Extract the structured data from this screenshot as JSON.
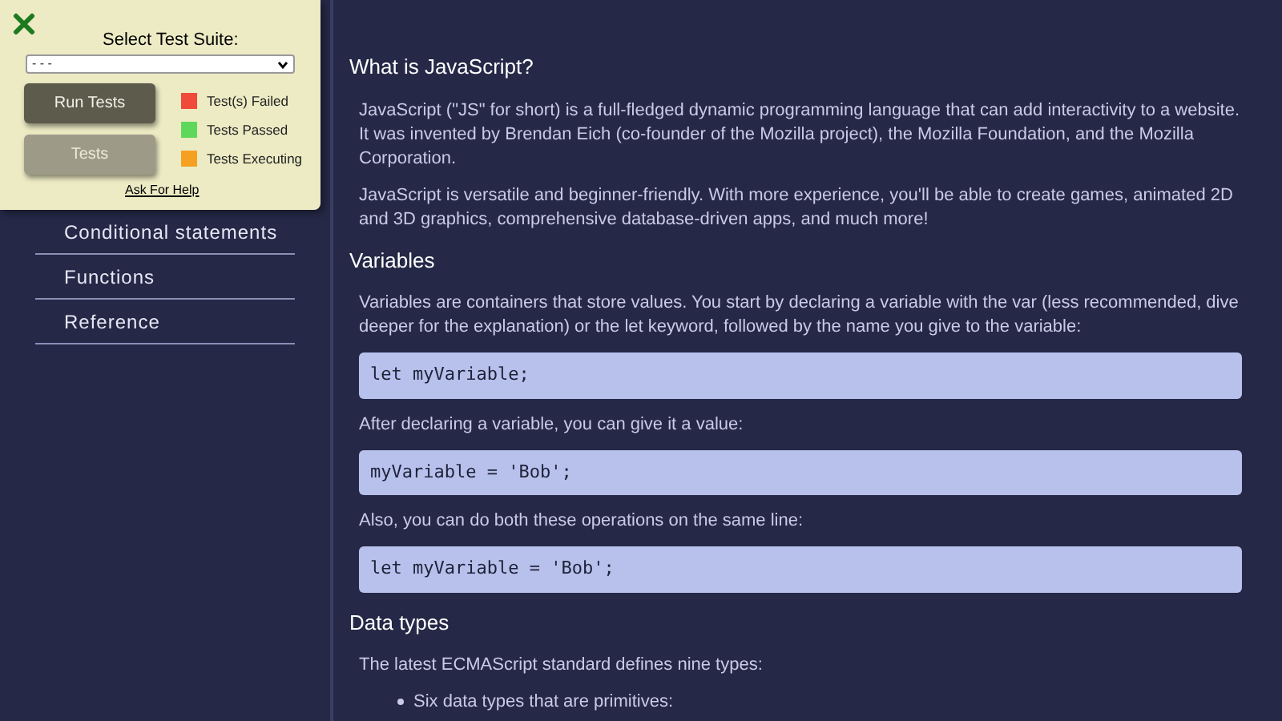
{
  "test_panel": {
    "title": "Select Test Suite:",
    "suite_select": {
      "value": "- - -"
    },
    "buttons": [
      {
        "label": "Run Tests",
        "disabled": false
      },
      {
        "label": "Tests",
        "disabled": true
      }
    ],
    "legend": [
      {
        "label": "Test(s) Failed",
        "color": "#f04a3a"
      },
      {
        "label": "Tests Passed",
        "color": "#5ed85a"
      },
      {
        "label": "Tests Executing",
        "color": "#f5a020"
      }
    ],
    "help_link": "Ask For Help"
  },
  "sidebar": {
    "items": [
      "Conditional statements",
      "Functions",
      "Reference"
    ]
  },
  "sections": [
    {
      "heading": "What is JavaScript?",
      "blocks": [
        {
          "kind": "text",
          "text": "JavaScript (\"JS\" for short) is a full-fledged dynamic programming language that can add interactivity to a website. It was invented by Brendan Eich (co-founder of the Mozilla project), the Mozilla Foundation, and the Mozilla Corporation."
        },
        {
          "kind": "text",
          "text": "JavaScript is versatile and beginner-friendly. With more experience, you'll be able to create games, animated 2D and 3D graphics, comprehensive database-driven apps, and much more!"
        }
      ]
    },
    {
      "heading": "Variables",
      "blocks": [
        {
          "kind": "text",
          "text": "Variables are containers that store values. You start by declaring a variable with the var (less recommended, dive deeper for the explanation) or the let keyword, followed by the name you give to the variable:"
        },
        {
          "kind": "code",
          "text": "let myVariable;"
        },
        {
          "kind": "text",
          "text": "After declaring a variable, you can give it a value:"
        },
        {
          "kind": "code",
          "text": "myVariable = 'Bob';"
        },
        {
          "kind": "text",
          "text": "Also, you can do both these operations on the same line:"
        },
        {
          "kind": "code",
          "text": "let myVariable = 'Bob';"
        }
      ]
    },
    {
      "heading": "Data types",
      "blocks": [
        {
          "kind": "text",
          "text": "The latest ECMAScript standard defines nine types:"
        },
        {
          "kind": "bullet",
          "text": "Six data types that are primitives:"
        }
      ]
    }
  ]
}
